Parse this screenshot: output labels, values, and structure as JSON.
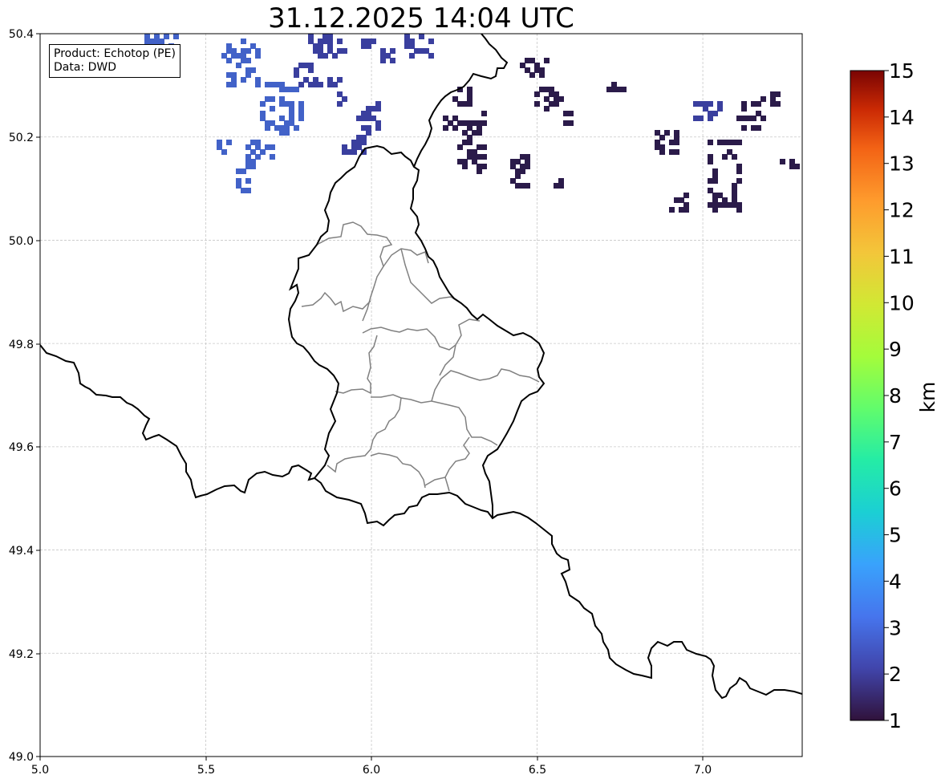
{
  "title": "31.12.2025 14:04 UTC",
  "info": {
    "product_line": "Product: Echotop (PE)",
    "data_line": "Data: DWD"
  },
  "map": {
    "lon_range": [
      5.0,
      7.3
    ],
    "lat_range": [
      49.0,
      50.4
    ],
    "x_ticks": [
      "5.0",
      "5.5",
      "6.0",
      "6.5",
      "7.0"
    ],
    "y_ticks": [
      "50.4",
      "50.2",
      "50.0",
      "49.8",
      "49.6",
      "49.4",
      "49.2",
      "49.0"
    ],
    "grid": true,
    "border_color": "#000000",
    "admin_border_color": "#808080"
  },
  "colorbar": {
    "label": "km",
    "ticks": [
      "15",
      "14",
      "13",
      "12",
      "11",
      "10",
      "9",
      "8",
      "7",
      "6",
      "5",
      "4",
      "3",
      "2",
      "1"
    ],
    "range": [
      1,
      15
    ],
    "colormap": "turbo",
    "colors": [
      "#30123b",
      "#4454c4",
      "#4490fe",
      "#1fc8de",
      "#29efa2",
      "#7dff56",
      "#c1f334",
      "#f1ca3a",
      "#fe922a",
      "#ea4f0d",
      "#be2102",
      "#7a0403"
    ]
  },
  "echoes": {
    "dark_color": "#2b1b4a",
    "mid_color": "#3a3f9e",
    "light_color": "#4262c8"
  }
}
